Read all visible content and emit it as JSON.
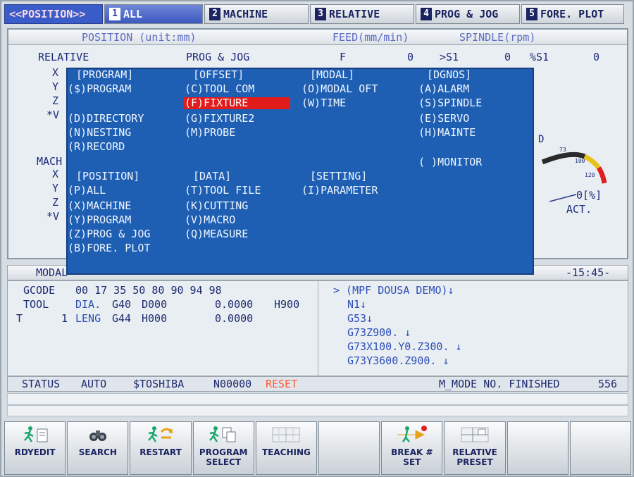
{
  "tabs": [
    {
      "label": "<<POSITION>>",
      "num": ""
    },
    {
      "label": "ALL",
      "num": "1"
    },
    {
      "label": "MACHINE",
      "num": "2"
    },
    {
      "label": "RELATIVE",
      "num": "3"
    },
    {
      "label": "PROG & JOG",
      "num": "4"
    },
    {
      "label": "FORE. PLOT",
      "num": "5"
    }
  ],
  "header": {
    "position": "POSITION (unit:mm)",
    "feed": "FEED(mm/min)",
    "spindle": "SPINDLE(rpm)"
  },
  "position": {
    "relative": "RELATIVE",
    "prog_jog": "PROG & JOG",
    "f_label": "F",
    "f_value": "0",
    "s1_label": ">S1",
    "s1_value": "0",
    "pct_s1_label": "%S1",
    "pct_s1_value": "0",
    "axes_relative": [
      "X",
      "Y",
      "Z",
      "*V"
    ],
    "mach_label": "MACH",
    "axes_machine": [
      "X",
      "Y",
      "Z",
      "*V"
    ]
  },
  "gauge": {
    "partial_label": "D",
    "tick_73": "73",
    "tick_100": "100",
    "tick_120": "120",
    "act_label": "ACT.",
    "act_value": "0[%]"
  },
  "menu": {
    "program": {
      "title": "[PROGRAM]",
      "items": [
        "($)PROGRAM",
        "(D)DIRECTORY",
        "(N)NESTING",
        "(R)RECORD"
      ]
    },
    "offset": {
      "title": "[OFFSET]",
      "items": [
        "(C)TOOL COM",
        "(F)FIXTURE",
        "(G)FIXTURE2",
        "(M)PROBE"
      ]
    },
    "modal": {
      "title": "[MODAL]",
      "items": [
        "(O)MODAL OFT",
        "(W)TIME"
      ]
    },
    "dgnos": {
      "title": "[DGNOS]",
      "items": [
        "(A)ALARM",
        "(S)SPINDLE",
        "(E)SERVO",
        "(H)MAINTE",
        "( )MONITOR"
      ]
    },
    "position": {
      "title": "[POSITION]",
      "items": [
        "(P)ALL",
        "(X)MACHINE",
        "(Y)PROGRAM",
        "(Z)PROG & JOG",
        "(B)FORE. PLOT"
      ]
    },
    "data": {
      "title": "[DATA]",
      "items": [
        "(T)TOOL FILE",
        "(K)CUTTING",
        "(V)MACRO",
        "(Q)MEASURE"
      ]
    },
    "setting": {
      "title": "[SETTING]",
      "items": [
        "(I)PARAMETER"
      ]
    }
  },
  "modal_bar": {
    "label": "MODAL",
    "time": "-15:45-"
  },
  "modal_info": {
    "gcode_label": "GCODE",
    "gcode_values": "00 17 35 50 80 90 94 98",
    "tool_label": "TOOL",
    "dia_label": "DIA.",
    "g40": "G40",
    "d000": "D000",
    "dia_value": "0.0000",
    "h900": "H900",
    "t_label": "T",
    "t_value": "1",
    "leng_label": "LENG",
    "g44": "G44",
    "h000": "H000",
    "leng_value": "0.0000"
  },
  "program_lines": [
    "> (MPF DOUSA DEMO)↓",
    "N1↓",
    "G53↓",
    "G73Z900. ↓",
    "G73X100.Y0.Z300. ↓",
    "G73Y3600.Z900. ↓"
  ],
  "status": {
    "label": "STATUS",
    "mode": "AUTO",
    "prog": "$TOSHIBA",
    "seq": "N00000",
    "reset": "RESET",
    "m_mode": "M_MODE NO. FINISHED",
    "count": "556"
  },
  "softkeys": [
    {
      "label": "RDYEDIT",
      "icon": "runner-doc-icon"
    },
    {
      "label": "SEARCH",
      "icon": "binoculars-icon"
    },
    {
      "label": "RESTART",
      "icon": "runner-restart-icon"
    },
    {
      "label": "PROGRAM SELECT",
      "icon": "runner-select-icon"
    },
    {
      "label": "TEACHING",
      "icon": "grid-icon"
    },
    {
      "label": "",
      "icon": ""
    },
    {
      "label": "BREAK # SET",
      "icon": "break-icon"
    },
    {
      "label": "RELATIVE PRESET",
      "icon": "crosshair-icon"
    },
    {
      "label": "",
      "icon": ""
    },
    {
      "label": "",
      "icon": ""
    }
  ],
  "colors": {
    "menu_bg": "#1f5fb3",
    "selection": "#e21b1b",
    "reset": "#ff5a3a"
  }
}
